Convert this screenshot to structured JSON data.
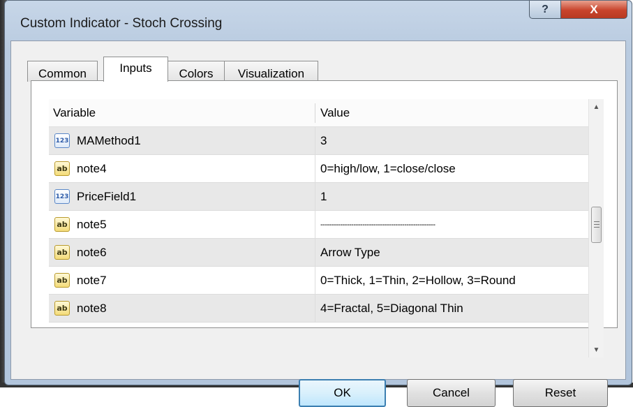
{
  "window": {
    "title": "Custom Indicator - Stoch Crossing",
    "help_glyph": "?",
    "close_glyph": "X"
  },
  "tabs": [
    {
      "label": "Common"
    },
    {
      "label": "Inputs"
    },
    {
      "label": "Colors"
    },
    {
      "label": "Visualization"
    }
  ],
  "grid": {
    "header": {
      "variable": "Variable",
      "value": "Value"
    },
    "rows": [
      {
        "icon": "number-icon",
        "icon_text": "123",
        "variable": "MAMethod1",
        "value": "3"
      },
      {
        "icon": "text-icon",
        "icon_text": "ab",
        "variable": "note4",
        "value": "0=high/low, 1=close/close"
      },
      {
        "icon": "number-icon",
        "icon_text": "123",
        "variable": "PriceField1",
        "value": "1"
      },
      {
        "icon": "text-icon",
        "icon_text": "ab",
        "variable": "note5",
        "value": "----------------------------------------------------"
      },
      {
        "icon": "text-icon",
        "icon_text": "ab",
        "variable": "note6",
        "value": "Arrow Type"
      },
      {
        "icon": "text-icon",
        "icon_text": "ab",
        "variable": "note7",
        "value": "0=Thick, 1=Thin, 2=Hollow, 3=Round"
      },
      {
        "icon": "text-icon",
        "icon_text": "ab",
        "variable": "note8",
        "value": "4=Fractal, 5=Diagonal Thin"
      }
    ]
  },
  "scrollbar": {
    "up_glyph": "▲",
    "down_glyph": "▼"
  },
  "buttons": {
    "ok": "OK",
    "cancel": "Cancel",
    "reset": "Reset"
  }
}
